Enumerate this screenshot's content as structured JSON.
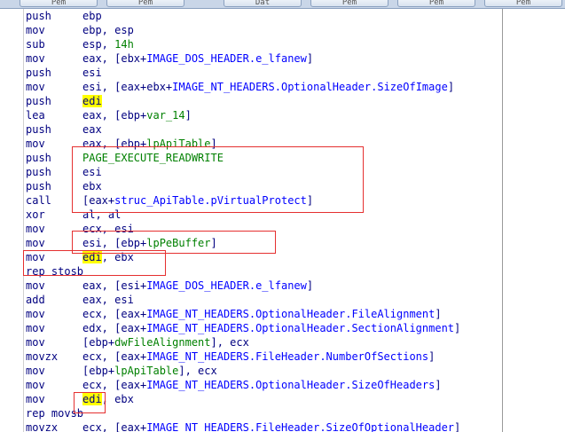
{
  "tabs": [
    {
      "label": "Pem"
    },
    {
      "label": "Pem"
    },
    {
      "label": "Dat"
    },
    {
      "label": "Pem"
    },
    {
      "label": "Pem"
    },
    {
      "label": "Pem"
    }
  ],
  "listing": [
    {
      "mnemonic": "push",
      "operand": [
        {
          "t": "ebp",
          "k": "reg"
        }
      ]
    },
    {
      "mnemonic": "mov",
      "operand": [
        {
          "t": "ebp, esp",
          "k": "reg"
        }
      ]
    },
    {
      "mnemonic": "sub",
      "operand": [
        {
          "t": "esp, ",
          "k": "reg"
        },
        {
          "t": "14h",
          "k": "num"
        }
      ]
    },
    {
      "mnemonic": "mov",
      "operand": [
        {
          "t": "eax, [ebx+",
          "k": "reg"
        },
        {
          "t": "IMAGE_DOS_HEADER.e_lfanew",
          "k": "sym"
        },
        {
          "t": "]",
          "k": "reg"
        }
      ]
    },
    {
      "mnemonic": "push",
      "operand": [
        {
          "t": "esi",
          "k": "reg"
        }
      ]
    },
    {
      "mnemonic": "mov",
      "operand": [
        {
          "t": "esi, [eax+ebx+",
          "k": "reg"
        },
        {
          "t": "IMAGE_NT_HEADERS.OptionalHeader.SizeOfImage",
          "k": "sym"
        },
        {
          "t": "]",
          "k": "reg"
        }
      ]
    },
    {
      "mnemonic": "push",
      "operand": [
        {
          "t": "edi",
          "k": "hl"
        }
      ]
    },
    {
      "mnemonic": "lea",
      "operand": [
        {
          "t": "eax, [ebp+",
          "k": "reg"
        },
        {
          "t": "var_14",
          "k": "var"
        },
        {
          "t": "]",
          "k": "reg"
        }
      ]
    },
    {
      "mnemonic": "push",
      "operand": [
        {
          "t": "eax",
          "k": "reg"
        }
      ]
    },
    {
      "mnemonic": "mov",
      "operand": [
        {
          "t": "eax, [ebp+",
          "k": "reg"
        },
        {
          "t": "lpApiTable",
          "k": "var"
        },
        {
          "t": "]",
          "k": "reg"
        }
      ]
    },
    {
      "mnemonic": "push",
      "operand": [
        {
          "t": "PAGE_EXECUTE_READWRITE",
          "k": "const"
        }
      ]
    },
    {
      "mnemonic": "push",
      "operand": [
        {
          "t": "esi",
          "k": "reg"
        }
      ]
    },
    {
      "mnemonic": "push",
      "operand": [
        {
          "t": "ebx",
          "k": "reg"
        }
      ]
    },
    {
      "mnemonic": "call",
      "operand": [
        {
          "t": "[eax+",
          "k": "reg"
        },
        {
          "t": "struc_ApiTable.pVirtualProtect",
          "k": "sym"
        },
        {
          "t": "]",
          "k": "reg"
        }
      ]
    },
    {
      "mnemonic": "xor",
      "operand": [
        {
          "t": "al, al",
          "k": "reg"
        }
      ]
    },
    {
      "mnemonic": "mov",
      "operand": [
        {
          "t": "ecx, esi",
          "k": "reg"
        }
      ]
    },
    {
      "mnemonic": "mov",
      "operand": [
        {
          "t": "esi, [ebp+",
          "k": "reg"
        },
        {
          "t": "lpPeBuffer",
          "k": "var"
        },
        {
          "t": "]",
          "k": "reg"
        }
      ]
    },
    {
      "mnemonic": "mov",
      "operand": [
        {
          "t": "edi",
          "k": "hl"
        },
        {
          "t": ", ebx",
          "k": "reg"
        }
      ]
    },
    {
      "mnemonic": "rep stosb",
      "operand": []
    },
    {
      "mnemonic": "mov",
      "operand": [
        {
          "t": "eax, [esi+",
          "k": "reg"
        },
        {
          "t": "IMAGE_DOS_HEADER.e_lfanew",
          "k": "sym"
        },
        {
          "t": "]",
          "k": "reg"
        }
      ]
    },
    {
      "mnemonic": "add",
      "operand": [
        {
          "t": "eax, esi",
          "k": "reg"
        }
      ]
    },
    {
      "mnemonic": "mov",
      "operand": [
        {
          "t": "ecx, [eax+",
          "k": "reg"
        },
        {
          "t": "IMAGE_NT_HEADERS.OptionalHeader.FileAlignment",
          "k": "sym"
        },
        {
          "t": "]",
          "k": "reg"
        }
      ]
    },
    {
      "mnemonic": "mov",
      "operand": [
        {
          "t": "edx, [eax+",
          "k": "reg"
        },
        {
          "t": "IMAGE_NT_HEADERS.OptionalHeader.SectionAlignment",
          "k": "sym"
        },
        {
          "t": "]",
          "k": "reg"
        }
      ]
    },
    {
      "mnemonic": "mov",
      "operand": [
        {
          "t": "[ebp+",
          "k": "reg"
        },
        {
          "t": "dwFileAlignment",
          "k": "var"
        },
        {
          "t": "], ecx",
          "k": "reg"
        }
      ]
    },
    {
      "mnemonic": "movzx",
      "operand": [
        {
          "t": "ecx, [eax+",
          "k": "reg"
        },
        {
          "t": "IMAGE_NT_HEADERS.FileHeader.NumberOfSections",
          "k": "sym"
        },
        {
          "t": "]",
          "k": "reg"
        }
      ]
    },
    {
      "mnemonic": "mov",
      "operand": [
        {
          "t": "[ebp+",
          "k": "reg"
        },
        {
          "t": "lpApiTable",
          "k": "var"
        },
        {
          "t": "], ecx",
          "k": "reg"
        }
      ]
    },
    {
      "mnemonic": "mov",
      "operand": [
        {
          "t": "ecx, [eax+",
          "k": "reg"
        },
        {
          "t": "IMAGE_NT_HEADERS.OptionalHeader.SizeOfHeaders",
          "k": "sym"
        },
        {
          "t": "]",
          "k": "reg"
        }
      ]
    },
    {
      "mnemonic": "mov",
      "operand": [
        {
          "t": "edi",
          "k": "hl"
        },
        {
          "t": ", ebx",
          "k": "reg"
        }
      ]
    },
    {
      "mnemonic": "rep movsb",
      "operand": []
    },
    {
      "mnemonic": "movzx",
      "operand": [
        {
          "t": "ecx, [eax+",
          "k": "reg"
        },
        {
          "t": "IMAGE_NT_HEADERS.FileHeader.SizeOfOptionalHeader",
          "k": "sym"
        },
        {
          "t": "]",
          "k": "reg"
        }
      ]
    }
  ],
  "colors": {
    "text": "#000080",
    "symbol": "#0000ff",
    "variable": "#008000",
    "constant": "#008000",
    "number": "#008000",
    "highlight": "#ffff00",
    "annotation": "#e53030"
  }
}
